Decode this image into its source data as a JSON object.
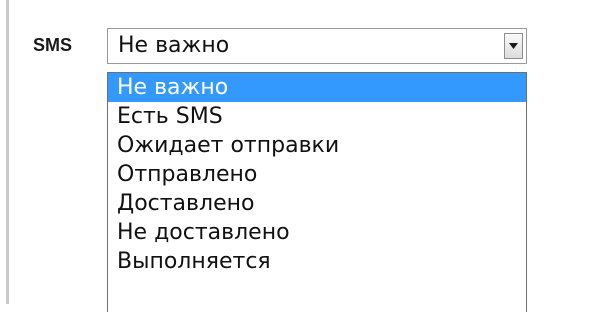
{
  "field": {
    "label": "SMS"
  },
  "select": {
    "value": "Не важно",
    "arrow_icon": "chevron-down-icon",
    "options": [
      "Не важно",
      "Есть SMS",
      "Ожидает отправки",
      "Отправлено",
      "Доставлено",
      "Не доставлено",
      "Выполняется"
    ],
    "highlighted_index": 0
  },
  "colors": {
    "highlight": "#3399ff",
    "highlight_text": "#ffffff",
    "border": "#6f6f6f"
  }
}
